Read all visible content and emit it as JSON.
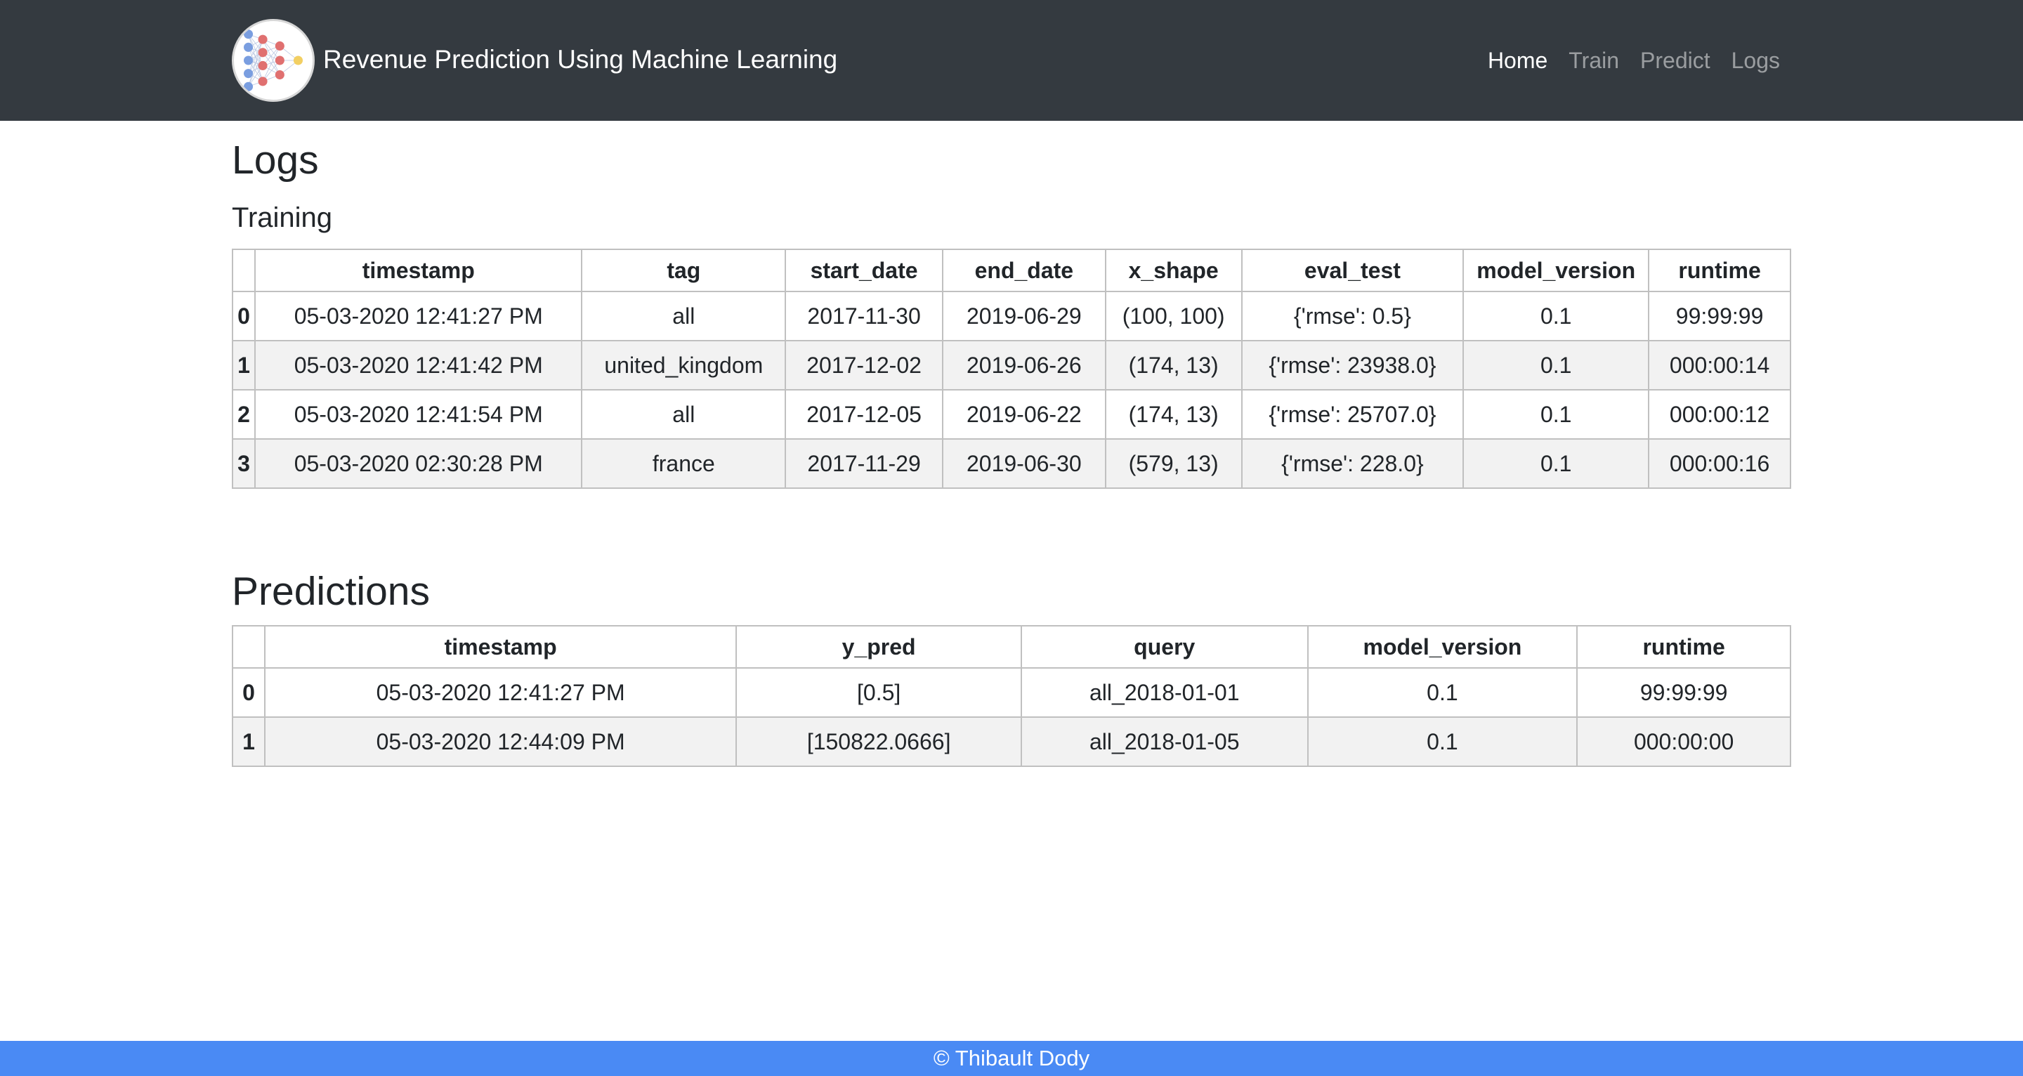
{
  "brand": {
    "title": "Revenue Prediction Using Machine Learning"
  },
  "nav": {
    "items": [
      {
        "label": "Home",
        "active": true
      },
      {
        "label": "Train",
        "active": false
      },
      {
        "label": "Predict",
        "active": false
      },
      {
        "label": "Logs",
        "active": false
      }
    ]
  },
  "page": {
    "title": "Logs"
  },
  "training": {
    "title": "Training",
    "columns": [
      "",
      "timestamp",
      "tag",
      "start_date",
      "end_date",
      "x_shape",
      "eval_test",
      "model_version",
      "runtime"
    ],
    "rows": [
      [
        "0",
        "05-03-2020 12:41:27 PM",
        "all",
        "2017-11-30",
        "2019-06-29",
        "(100, 100)",
        "{'rmse': 0.5}",
        "0.1",
        "99:99:99"
      ],
      [
        "1",
        "05-03-2020 12:41:42 PM",
        "united_kingdom",
        "2017-12-02",
        "2019-06-26",
        "(174, 13)",
        "{'rmse': 23938.0}",
        "0.1",
        "000:00:14"
      ],
      [
        "2",
        "05-03-2020 12:41:54 PM",
        "all",
        "2017-12-05",
        "2019-06-22",
        "(174, 13)",
        "{'rmse': 25707.0}",
        "0.1",
        "000:00:12"
      ],
      [
        "3",
        "05-03-2020 02:30:28 PM",
        "france",
        "2017-11-29",
        "2019-06-30",
        "(579, 13)",
        "{'rmse': 228.0}",
        "0.1",
        "000:00:16"
      ]
    ]
  },
  "predictions": {
    "title": "Predictions",
    "columns": [
      "",
      "timestamp",
      "y_pred",
      "query",
      "model_version",
      "runtime"
    ],
    "rows": [
      [
        "0",
        "05-03-2020 12:41:27 PM",
        "[0.5]",
        "all_2018-01-01",
        "0.1",
        "99:99:99"
      ],
      [
        "1",
        "05-03-2020 12:44:09 PM",
        "[150822.0666]",
        "all_2018-01-05",
        "0.1",
        "000:00:00"
      ]
    ]
  },
  "footer": {
    "text": "© Thibault Dody"
  },
  "colors": {
    "navbar": "#343a40",
    "footer": "#4a8af4",
    "stripe": "#f2f2f2",
    "logo_blue": "#7a9ee0",
    "logo_red": "#e07070",
    "logo_yellow": "#f2cf63"
  }
}
